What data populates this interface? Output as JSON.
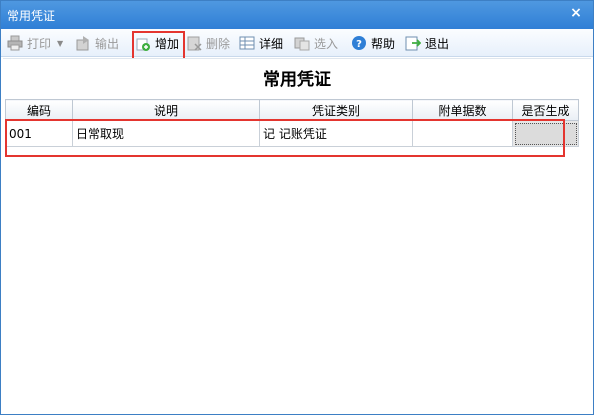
{
  "window": {
    "title": "常用凭证",
    "close": "×"
  },
  "toolbar": {
    "print": "打印",
    "export": "输出",
    "add": "增加",
    "delete": "删除",
    "detail": "详细",
    "select": "选入",
    "help": "帮助",
    "exit": "退出"
  },
  "main": {
    "heading": "常用凭证",
    "columns": [
      "编码",
      "说明",
      "凭证类别",
      "附单据数",
      "是否生成"
    ],
    "rows": [
      {
        "code": "001",
        "description": "日常取现",
        "voucher_type": "记  记账凭证",
        "attachments": "",
        "generated": ""
      }
    ]
  },
  "colors": {
    "title_bar": "#2f7fd6",
    "highlight": "#e4352f"
  }
}
